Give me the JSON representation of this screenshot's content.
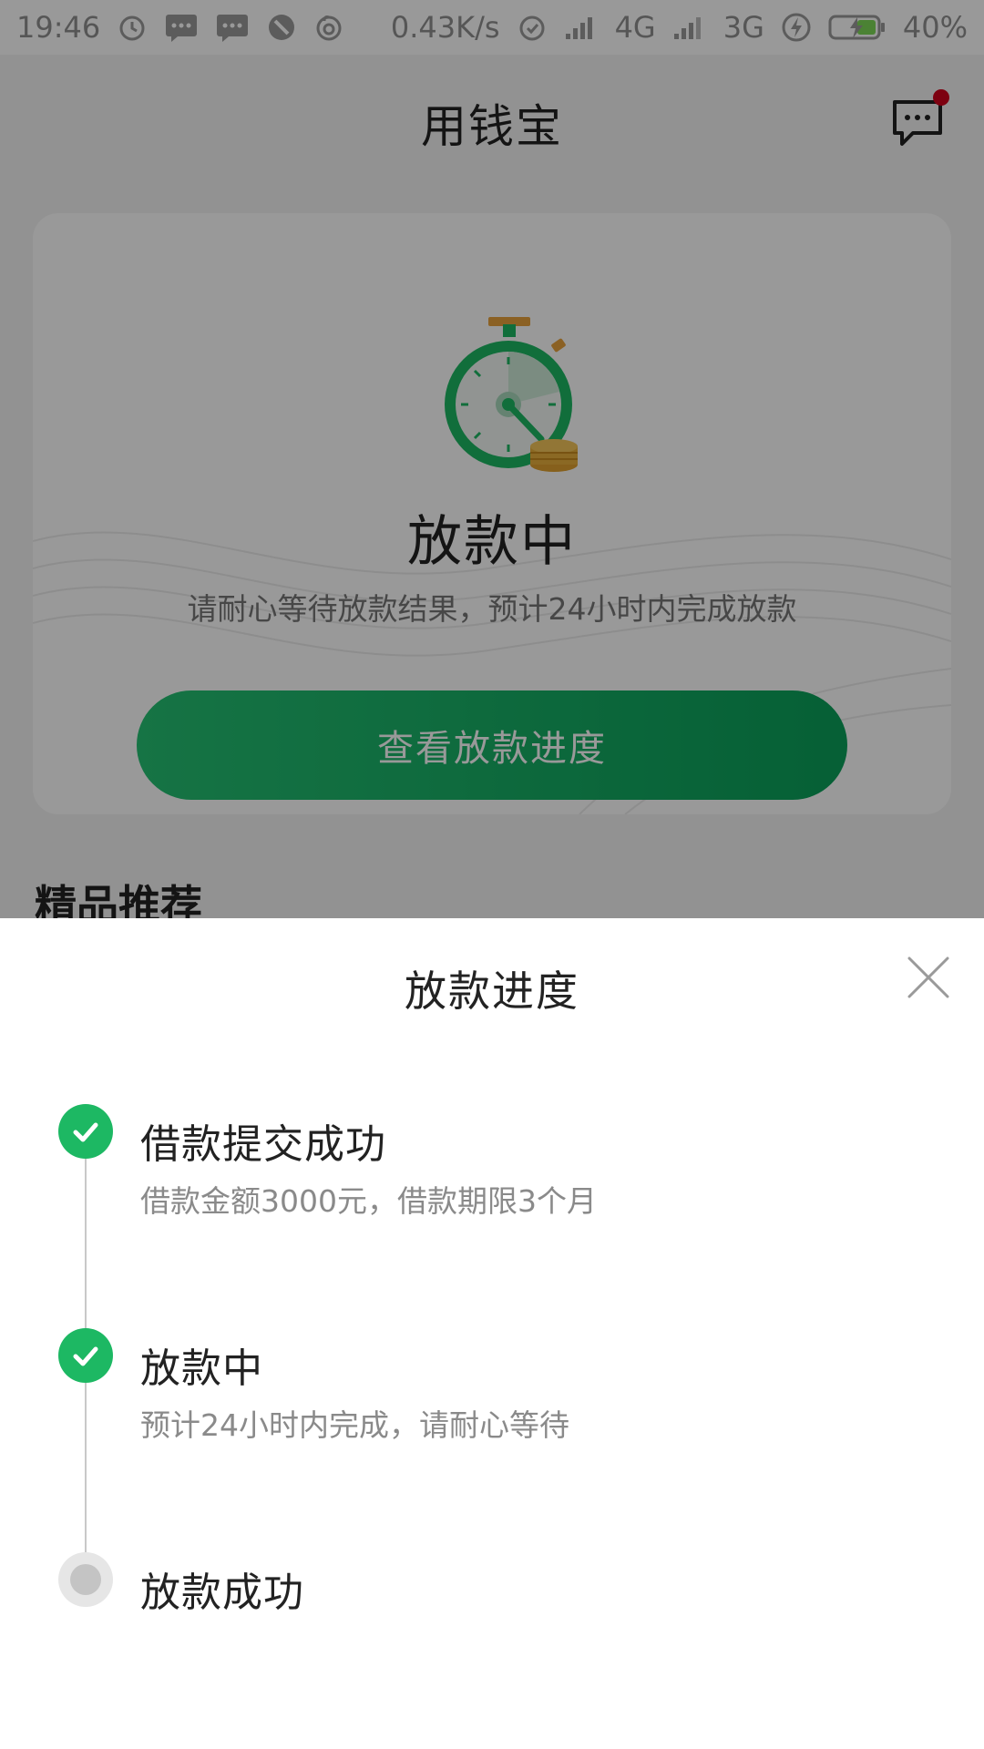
{
  "status_bar": {
    "time": "19:46",
    "net_speed": "0.43K/s",
    "network_1": "4G",
    "network_2": "3G",
    "battery": "40%",
    "left_icons": [
      "alarm-icon",
      "message-icon",
      "message-icon",
      "blocked-icon",
      "netease-icon"
    ],
    "right_icons": [
      "alarm-icon",
      "signal-icon",
      "signal-icon",
      "charging-icon",
      "battery-icon"
    ]
  },
  "app": {
    "nav_title": "用钱宝",
    "status_card": {
      "title": "放款中",
      "description": "请耐心等待放款结果，预计24小时内完成放款",
      "button_label": "查看放款进度"
    },
    "section_title": "精品推荐"
  },
  "sheet": {
    "title": "放款进度",
    "steps": [
      {
        "title": "借款提交成功",
        "description": "借款金额3000元，借款期限3个月",
        "state": "done"
      },
      {
        "title": "放款中",
        "description": "预计24小时内完成，请耐心等待",
        "state": "done"
      },
      {
        "title": "放款成功",
        "description": "",
        "state": "pending"
      }
    ]
  },
  "colors": {
    "accent_green": "#1db863",
    "pending_grey": "#c4c4c4",
    "notification_red": "#d0021b"
  }
}
